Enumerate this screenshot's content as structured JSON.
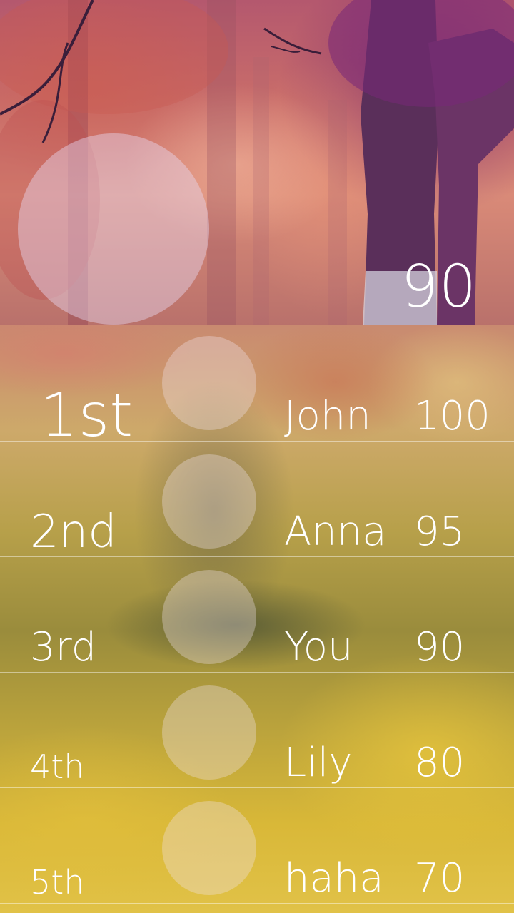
{
  "header": {
    "my_score": "90"
  },
  "leaderboard": {
    "rows": [
      {
        "rank": "1st",
        "name": "John",
        "score": "100"
      },
      {
        "rank": "2nd",
        "name": "Anna",
        "score": "95"
      },
      {
        "rank": "3rd",
        "name": "You",
        "score": "90"
      },
      {
        "rank": "4th",
        "name": "Lily",
        "score": "80"
      },
      {
        "rank": "5th",
        "name": "haha",
        "score": "70"
      }
    ]
  },
  "colors": {
    "text": "#ffffff",
    "header_tint": "#c86c6a",
    "board_tint": "#d9b838"
  }
}
